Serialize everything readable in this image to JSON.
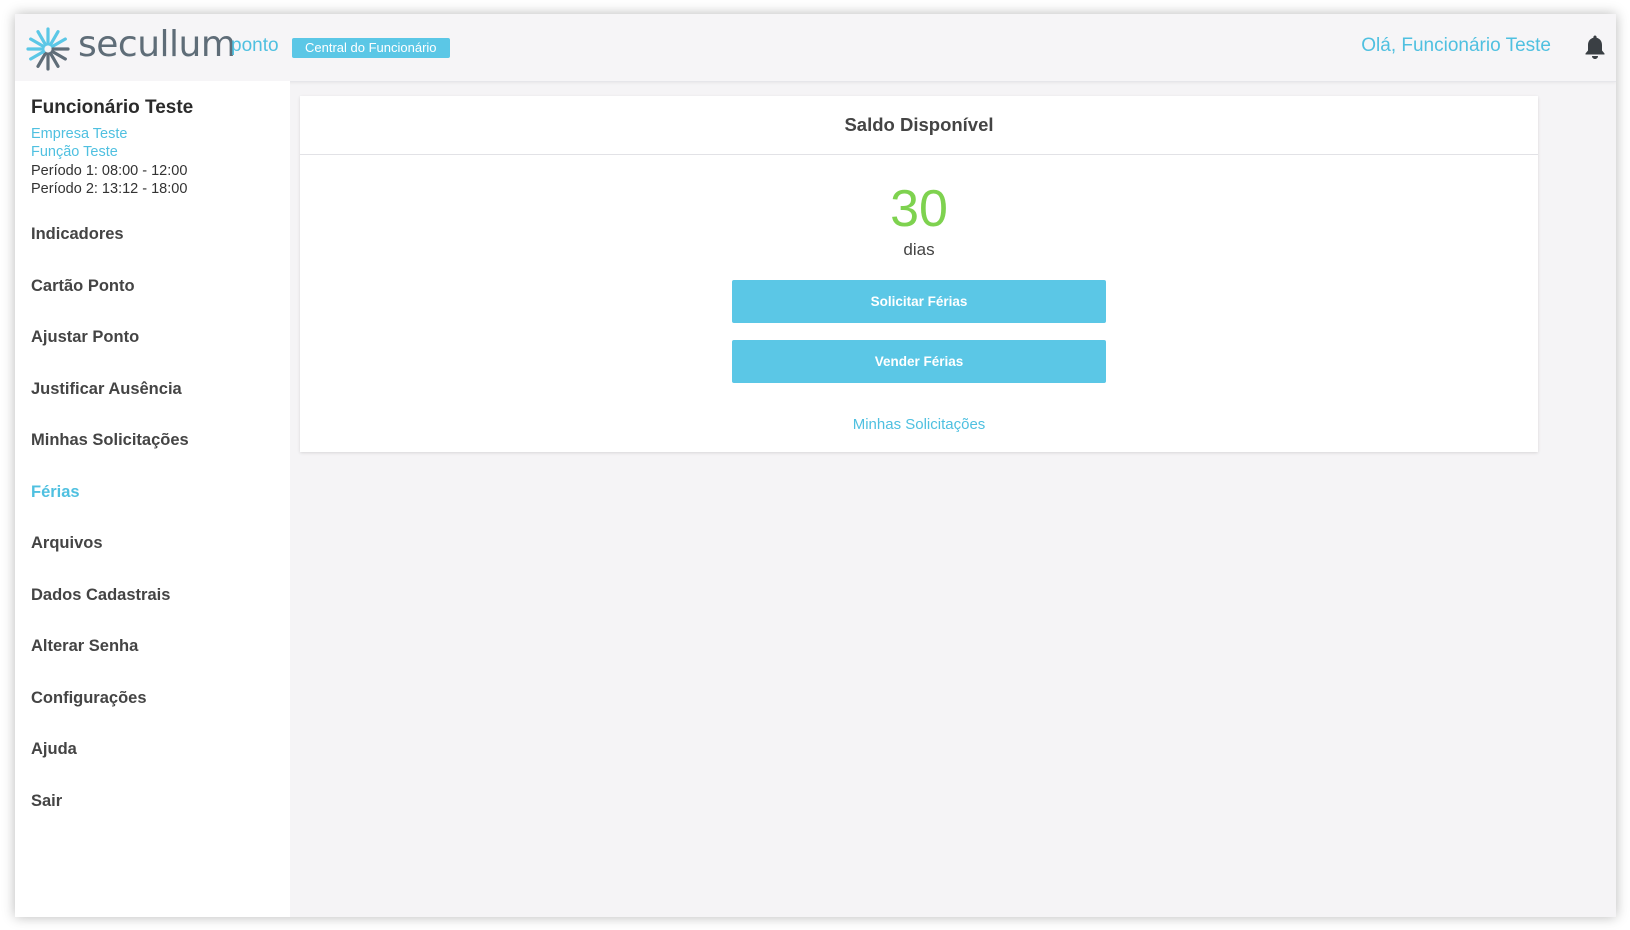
{
  "header": {
    "brand": "secullum",
    "product": "ponto",
    "badge": "Central do Funcionário",
    "greeting": "Olá, Funcionário Teste",
    "icons": {
      "logo": "secullum-logo-icon",
      "notifications": "bell-icon"
    },
    "accent_color": "#4fc0e0"
  },
  "sidebar": {
    "employee": {
      "name": "Funcionário Teste",
      "company": "Empresa Teste",
      "role": "Função Teste",
      "period1": "Período 1: 08:00 - 12:00",
      "period2": "Período 2: 13:12 - 18:00"
    },
    "items": [
      {
        "label": "Indicadores"
      },
      {
        "label": "Cartão Ponto"
      },
      {
        "label": "Ajustar Ponto"
      },
      {
        "label": "Justificar Ausência"
      },
      {
        "label": "Minhas Solicitações"
      },
      {
        "label": "Férias",
        "active": true
      },
      {
        "label": "Arquivos"
      },
      {
        "label": "Dados Cadastrais"
      },
      {
        "label": "Alterar Senha"
      },
      {
        "label": "Configurações"
      },
      {
        "label": "Ajuda"
      },
      {
        "label": "Sair"
      }
    ]
  },
  "main": {
    "card_title": "Saldo Disponível",
    "balance_value": "30",
    "balance_unit": "dias",
    "balance_color": "#7ed24f",
    "request_button": "Solicitar Férias",
    "sell_button": "Vender Férias",
    "requests_link": "Minhas Solicitações",
    "button_color": "#5bc7e6"
  }
}
